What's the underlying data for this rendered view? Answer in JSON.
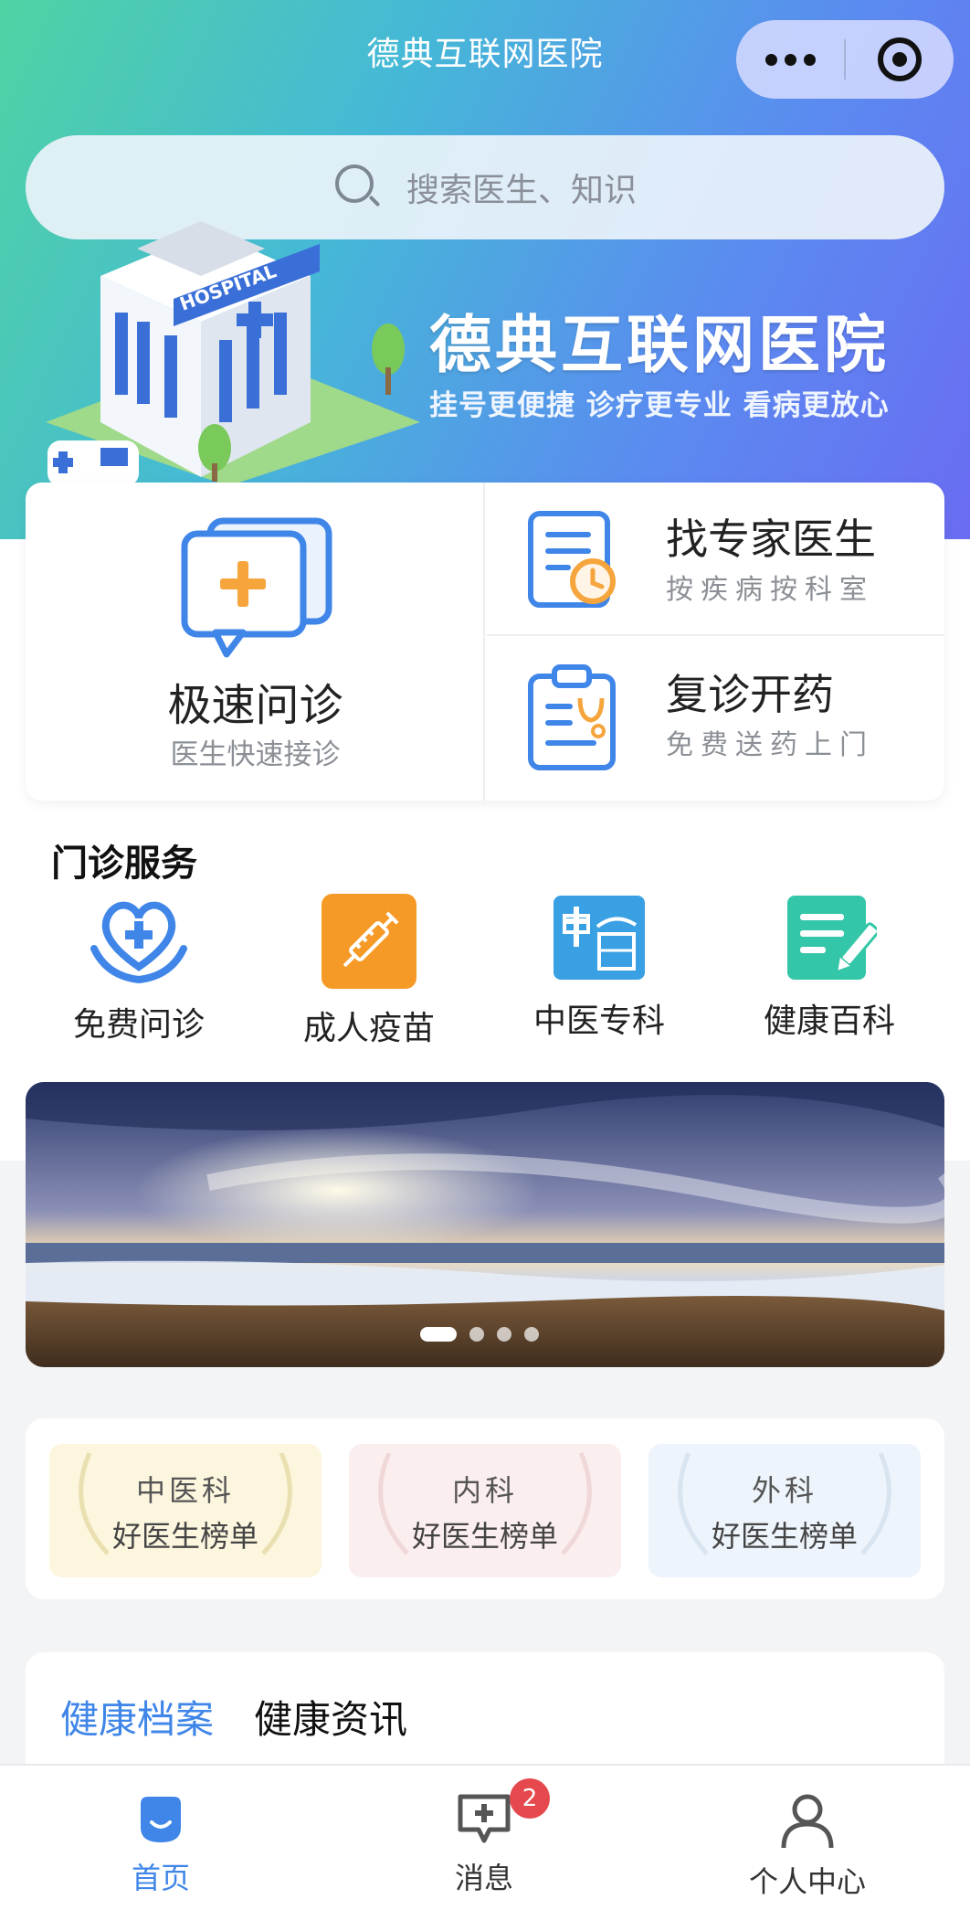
{
  "header": {
    "title": "德典互联网医院",
    "menu_icon": "more-dots-icon",
    "capsule_icon": "target-circle-icon"
  },
  "search": {
    "placeholder": "搜索医生、知识"
  },
  "hero": {
    "title": "德典互联网医院",
    "subtitle": "挂号更便捷 诊疗更专业 看病更放心",
    "building_sign": "HOSPITAL"
  },
  "quick": {
    "fast": {
      "title": "极速问诊",
      "subtitle": "医生快速接诊"
    },
    "expert": {
      "title": "找专家医生",
      "subtitle": "按疾病按科室"
    },
    "revisit": {
      "title": "复诊开药",
      "subtitle": "免费送药上门"
    }
  },
  "outpatient": {
    "title": "门诊服务",
    "items": [
      {
        "label": "免费问诊",
        "icon": "heart-hands-icon"
      },
      {
        "label": "成人疫苗",
        "icon": "syringe-icon"
      },
      {
        "label": "中医专科",
        "icon": "chinese-medicine-icon"
      },
      {
        "label": "健康百科",
        "icon": "note-pen-icon"
      }
    ]
  },
  "banner": {
    "slide_count": 4,
    "active_index": 0
  },
  "ranking": [
    {
      "dept": "中医科",
      "label": "好医生榜单"
    },
    {
      "dept": "内科",
      "label": "好医生榜单"
    },
    {
      "dept": "外科",
      "label": "好医生榜单"
    }
  ],
  "tabs": [
    {
      "label": "健康档案",
      "active": true
    },
    {
      "label": "健康资讯",
      "active": false
    }
  ],
  "bottom_nav": {
    "items": [
      {
        "label": "首页",
        "icon": "home-icon",
        "active": true
      },
      {
        "label": "消息",
        "icon": "message-icon",
        "active": false
      },
      {
        "label": "个人中心",
        "icon": "user-icon",
        "active": false
      }
    ],
    "message_badge": "2"
  },
  "colors": {
    "accent": "#3f86e8",
    "badge": "#e5484d",
    "orange": "#f5a53c"
  }
}
